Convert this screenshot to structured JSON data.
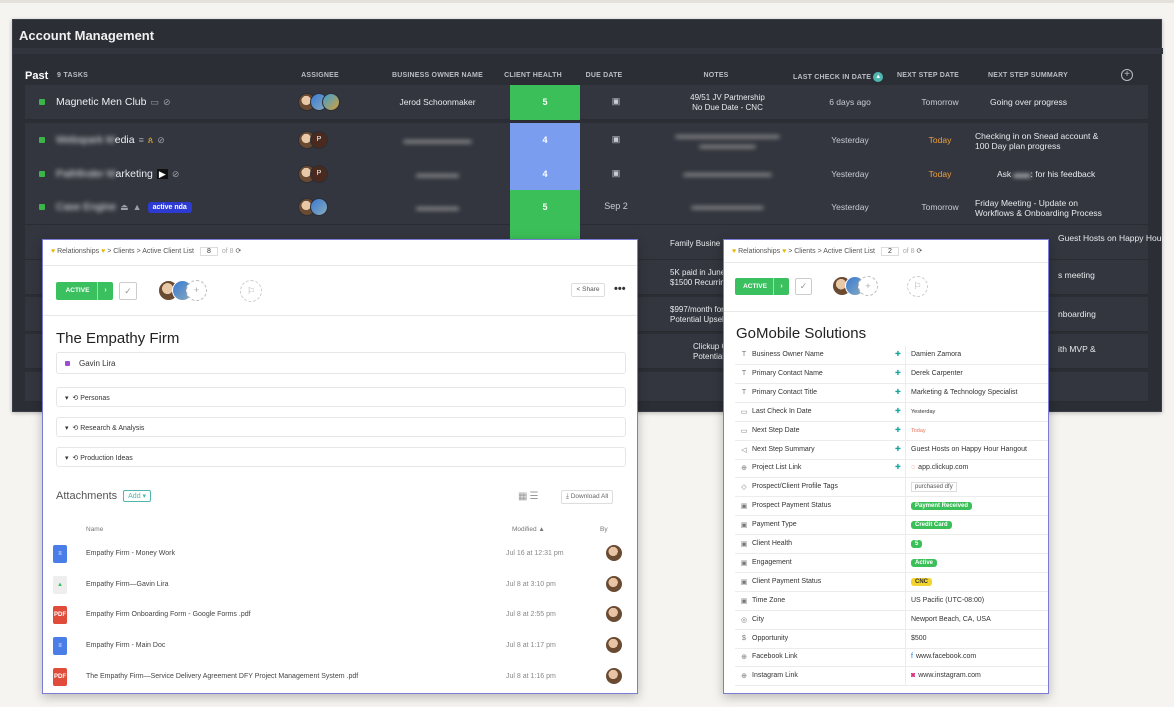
{
  "board": {
    "title": "Account Management",
    "group": "Past",
    "task_count": "9 TASKS",
    "columns": [
      "ASSIGNEE",
      "BUSINESS OWNER NAME",
      "CLIENT HEALTH",
      "DUE DATE",
      "NOTES",
      "LAST CHECK IN DATE",
      "NEXT STEP DATE",
      "NEXT STEP SUMMARY"
    ],
    "rows": [
      {
        "name": "Magnetic Men Club",
        "owner": "Jerod Schoonmaker",
        "health": "5",
        "health_color": "#3bbf58",
        "due": "",
        "notes": "49/51 JV Partnership\nNo Due Date - CNC",
        "last": "6 days ago",
        "next": "Tomorrow",
        "summary": "Going over progress"
      },
      {
        "name_blur": "Webspark M",
        "name": "edia",
        "owner": "",
        "health": "4",
        "health_color": "#7b9df0",
        "due": "",
        "notes": "",
        "last": "Yesterday",
        "next": "Today",
        "summary": "Checking in on Snead account &\n100 Day plan progress"
      },
      {
        "name_blur": "Pathfinder M",
        "name": "arketing",
        "owner": "",
        "health": "4",
        "health_color": "#7b9df0",
        "due": "",
        "notes": "",
        "last": "Yesterday",
        "next": "Today",
        "summary_a": "Ask",
        "summary_b": ": for his feedback"
      },
      {
        "name_blur": "Case Engine",
        "name": "",
        "tag": "active nda",
        "owner": "",
        "health": "5",
        "health_color": "#3bbf58",
        "due": "Sep 2",
        "notes": "",
        "last": "Yesterday",
        "next": "Tomorrow",
        "summary": "Friday Meeting - Update on\nWorkflows & Onboarding Process"
      },
      {
        "partial_notes": "Family Busine",
        "partial_summary": "Guest Hosts on Happy Hour"
      },
      {
        "partial_notes": "5K paid in June - 5\n$1500 Recurring st",
        "partial_summary": "s meeting"
      },
      {
        "partial_notes": "$997/month for 6\nPotential Upsell",
        "partial_summary": "nboarding"
      },
      {
        "partial_notes": "Clickup Onl\nPotential Up",
        "partial_summary": "ith MVP &"
      },
      {
        "partial_notes": "–",
        "partial_summary": ""
      }
    ]
  },
  "modal_left": {
    "crumbs": [
      "Relationships",
      "Clients",
      "Active Client List"
    ],
    "page": "8",
    "of": "of 8",
    "status": "ACTIVE",
    "share": "Share",
    "title": "The Empathy Firm",
    "assignee": "Gavin Lira",
    "sections": [
      "Personas",
      "Research & Analysis",
      "Production Ideas"
    ],
    "attachments_label": "Attachments",
    "add_label": "Add",
    "download_all": "Download All",
    "col_name": "Name",
    "col_modified": "Modified",
    "col_by": "By",
    "files": [
      {
        "name": "Empathy Firm - Money Work",
        "modified": "Jul 16 at 12:31 pm",
        "type": "doc"
      },
      {
        "name": "Empathy Firm—Gavin Lira",
        "modified": "Jul 8 at 3:10 pm",
        "type": "img"
      },
      {
        "name": "Empathy Firm Onboarding Form - Google Forms .pdf",
        "modified": "Jul 8 at 2:55 pm",
        "type": "pdf"
      },
      {
        "name": "Empathy Firm - Main Doc",
        "modified": "Jul 8 at 1:17 pm",
        "type": "doc"
      },
      {
        "name": "The Empathy Firm—Service Delivery Agreement DFY Project Management System .pdf",
        "modified": "Jul 8 at 1:16 pm",
        "type": "pdf"
      }
    ]
  },
  "modal_right": {
    "crumbs": [
      "Relationships",
      "Clients",
      "Active Client List"
    ],
    "page": "2",
    "of": "of 8",
    "status": "ACTIVE",
    "title": "GoMobile Solutions",
    "fields": [
      {
        "icon": "T",
        "label": "Business Owner Name",
        "pin": true,
        "value": "Damien Zamora"
      },
      {
        "icon": "T",
        "label": "Primary Contact Name",
        "pin": true,
        "value": "Derek Carpenter"
      },
      {
        "icon": "T",
        "label": "Primary Contact Title",
        "pin": true,
        "value": "Marketing & Technology Specialist"
      },
      {
        "icon": "▭",
        "label": "Last Check In Date",
        "pin": true,
        "value": "Yesterday",
        "small": true
      },
      {
        "icon": "▭",
        "label": "Next Step Date",
        "pin": true,
        "value": "Today",
        "color": "#e8785a",
        "small": true
      },
      {
        "icon": "◁",
        "label": "Next Step Summary",
        "pin": true,
        "value": "Guest Hosts on Happy Hour Hangout"
      },
      {
        "icon": "⊕",
        "label": "Project List Link",
        "pin": true,
        "value": "app.clickup.com",
        "prefix": "◌"
      },
      {
        "icon": "◇",
        "label": "Prospect/Client Profile Tags",
        "value": "purchased dfy",
        "tag": true
      },
      {
        "icon": "▣",
        "label": "Prospect Payment Status",
        "pill": "Payment Received",
        "pill_color": "#3bbf58"
      },
      {
        "icon": "▣",
        "label": "Payment Type",
        "pill": "Credit Card",
        "pill_color": "#3bbf58"
      },
      {
        "icon": "▣",
        "label": "Client Health",
        "pill": "5",
        "pill_color": "#3bbf58"
      },
      {
        "icon": "▣",
        "label": "Engagement",
        "pill": "Active",
        "pill_color": "#3bbf58"
      },
      {
        "icon": "▣",
        "label": "Client Payment Status",
        "pill": "CNC",
        "pill_color": "#f2d42c",
        "pill_text": "#333"
      },
      {
        "icon": "▣",
        "label": "Time Zone",
        "value": "US Pacific (UTC-08:00)"
      },
      {
        "icon": "◎",
        "label": "City",
        "value": "Newport Beach, CA, USA"
      },
      {
        "icon": "$",
        "label": "Opportunity",
        "value": "$500"
      },
      {
        "icon": "⊕",
        "label": "Facebook Link",
        "value": "www.facebook.com",
        "prefix": "f"
      },
      {
        "icon": "⊕",
        "label": "Instagram Link",
        "value": "www.instagram.com",
        "prefix": "◙"
      }
    ]
  }
}
